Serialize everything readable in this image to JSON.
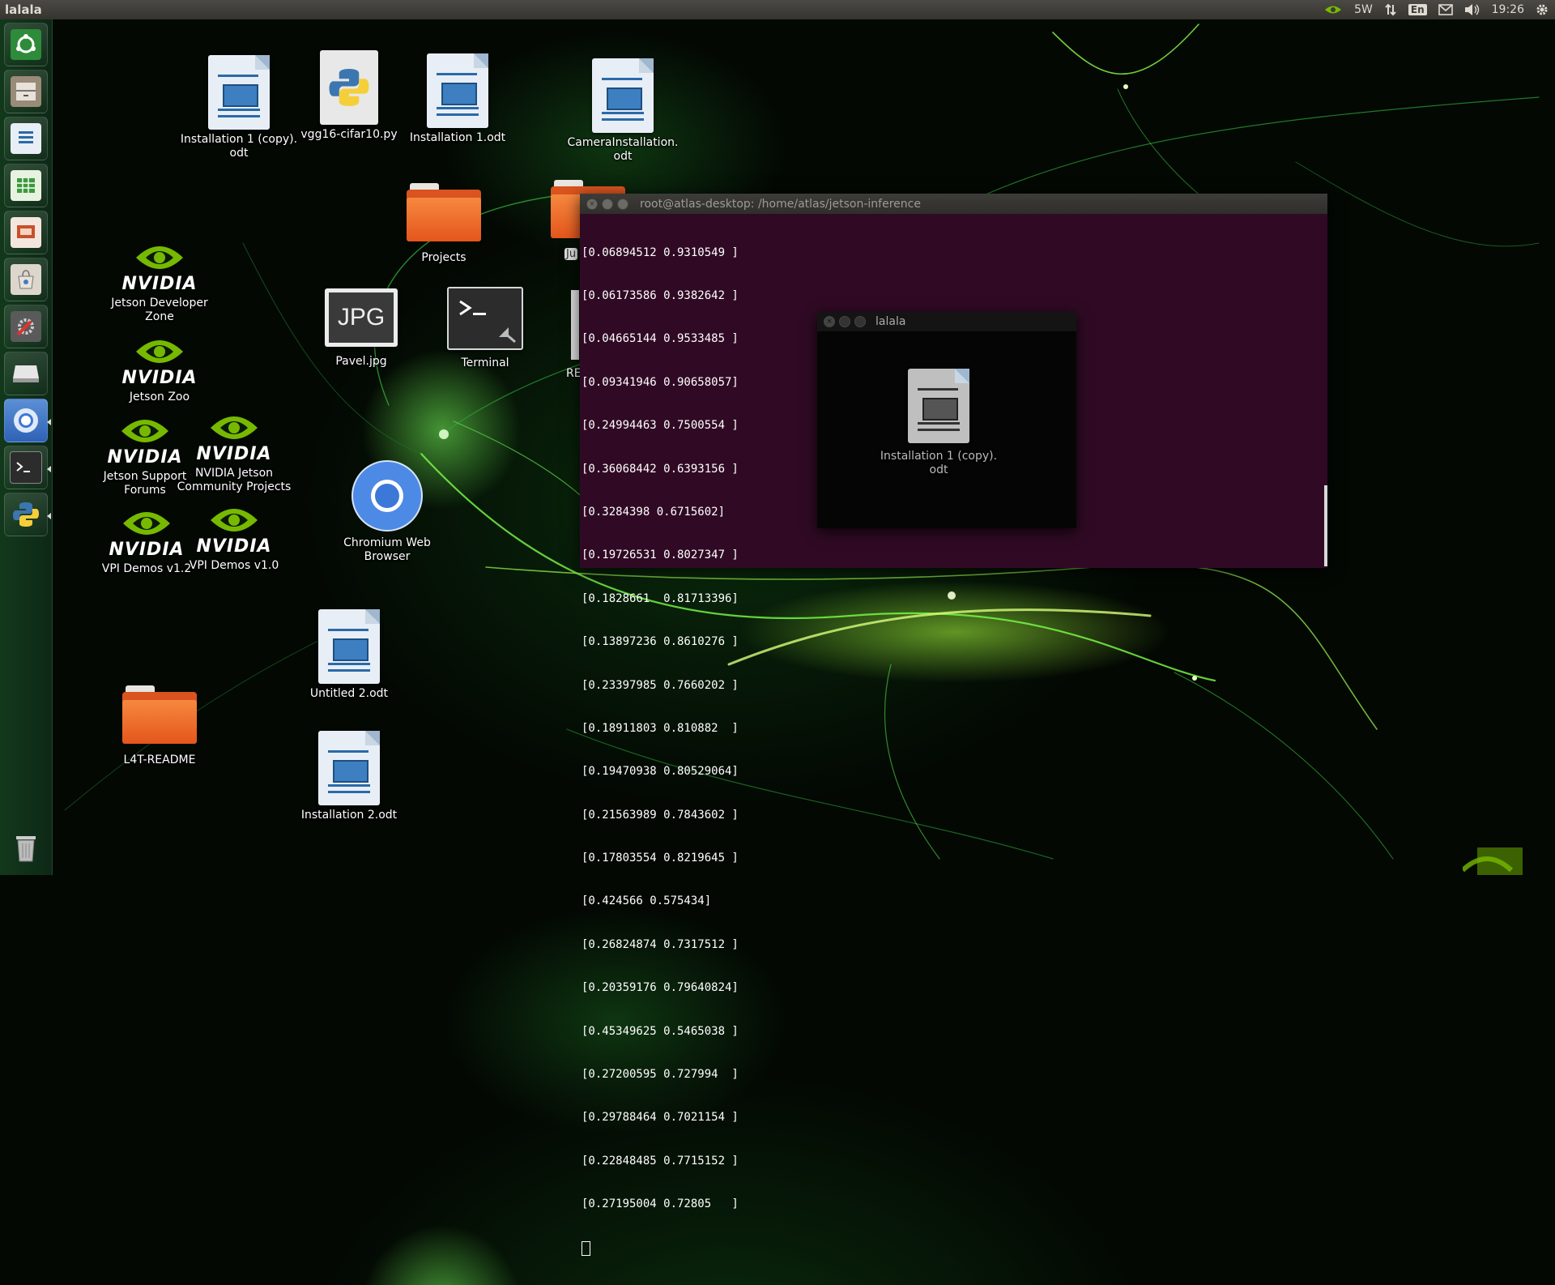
{
  "top_panel": {
    "title": "lalala",
    "tray": {
      "power": "5W",
      "lang": "En",
      "time": "19:26"
    }
  },
  "launcher": {
    "items": [
      {
        "name": "dash-home"
      },
      {
        "name": "file-manager"
      },
      {
        "name": "libreoffice-writer"
      },
      {
        "name": "libreoffice-calc"
      },
      {
        "name": "libreoffice-impress"
      },
      {
        "name": "software-center"
      },
      {
        "name": "system-settings"
      },
      {
        "name": "drive"
      },
      {
        "name": "chromium"
      },
      {
        "name": "terminal"
      },
      {
        "name": "python"
      },
      {
        "name": "trash"
      }
    ]
  },
  "desktop": {
    "icons": {
      "installation_copy": "Installation 1 (copy).\nodt",
      "vgg16": "vgg16-cifar10.py",
      "installation1": "Installation 1.odt",
      "camera_installation": "CameraInstallation.\nodt",
      "projects": "Projects",
      "jetson_dev_zone": "Jetson Developer\nZone",
      "jetson_zoo": "Jetson Zoo",
      "pavel_jpg": "Pavel.jpg",
      "jpg_badge": "JPG",
      "terminal": "Terminal",
      "re_partial": "RE",
      "ju_partial": "Ju",
      "jetson_support": "Jetson Support\nForums",
      "nvidia_community": "NVIDIA Jetson\nCommunity Projects",
      "chromium": "Chromium Web\nBrowser",
      "vpi_12": "VPI Demos v1.2",
      "vpi_10": "VPI Demos v1.0",
      "untitled2": "Untitled 2.odt",
      "l4t_readme": "L4T-README",
      "installation2": "Installation 2.odt",
      "nvidia_wordmark": "NVIDIA"
    }
  },
  "terminal": {
    "title": "root@atlas-desktop: /home/atlas/jetson-inference",
    "lines": [
      "[0.06894512 0.9310549 ]",
      "[0.06173586 0.9382642 ]",
      "[0.04665144 0.9533485 ]",
      "[0.09341946 0.90658057]",
      "[0.24994463 0.7500554 ]",
      "[0.36068442 0.6393156 ]",
      "[0.3284398 0.6715602]",
      "[0.19726531 0.8027347 ]",
      "[0.1828661  0.81713396]",
      "[0.13897236 0.8610276 ]",
      "[0.23397985 0.7660202 ]",
      "[0.18911803 0.810882  ]",
      "[0.19470938 0.80529064]",
      "[0.21563989 0.7843602 ]",
      "[0.17803554 0.8219645 ]",
      "[0.424566 0.575434]",
      "[0.26824874 0.7317512 ]",
      "[0.20359176 0.79640824]",
      "[0.45349625 0.5465038 ]",
      "[0.27200595 0.727994  ]",
      "[0.29788464 0.7021154 ]",
      "[0.22848485 0.7715152 ]",
      "[0.27195004 0.72805   ]"
    ]
  },
  "lalala_window": {
    "title": "lalala",
    "icon_label": "Installation 1 (copy).\nodt"
  }
}
